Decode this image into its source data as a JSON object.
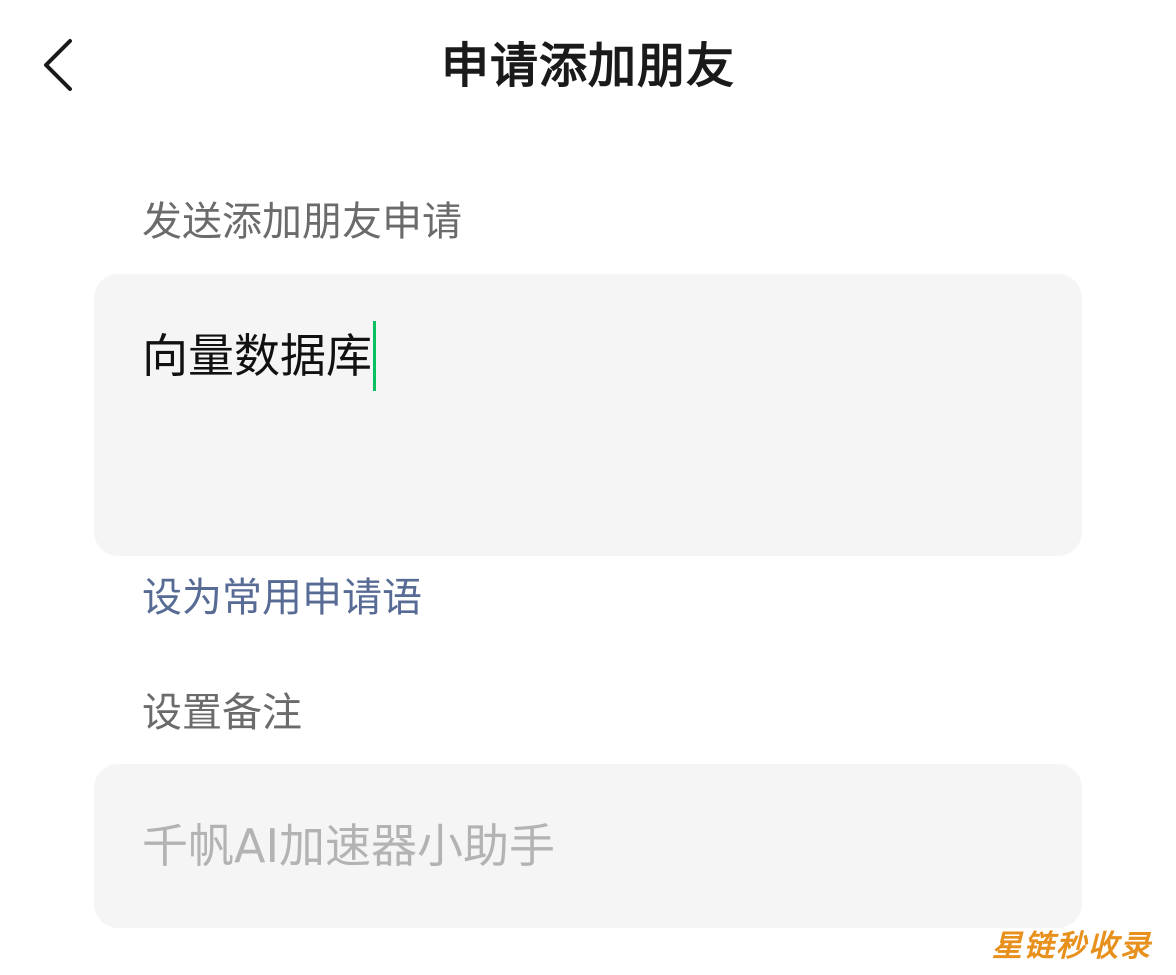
{
  "header": {
    "back_icon": "chevron-left-icon",
    "title": "申请添加朋友"
  },
  "request": {
    "label": "发送添加朋友申请",
    "message": "向量数据库",
    "caret_color": "#07c160",
    "set_common_label": "设为常用申请语",
    "link_color": "#576b95"
  },
  "remark": {
    "label": "设置备注",
    "placeholder": "千帆AI加速器小助手"
  },
  "watermark": {
    "text": "星链秒收录"
  }
}
